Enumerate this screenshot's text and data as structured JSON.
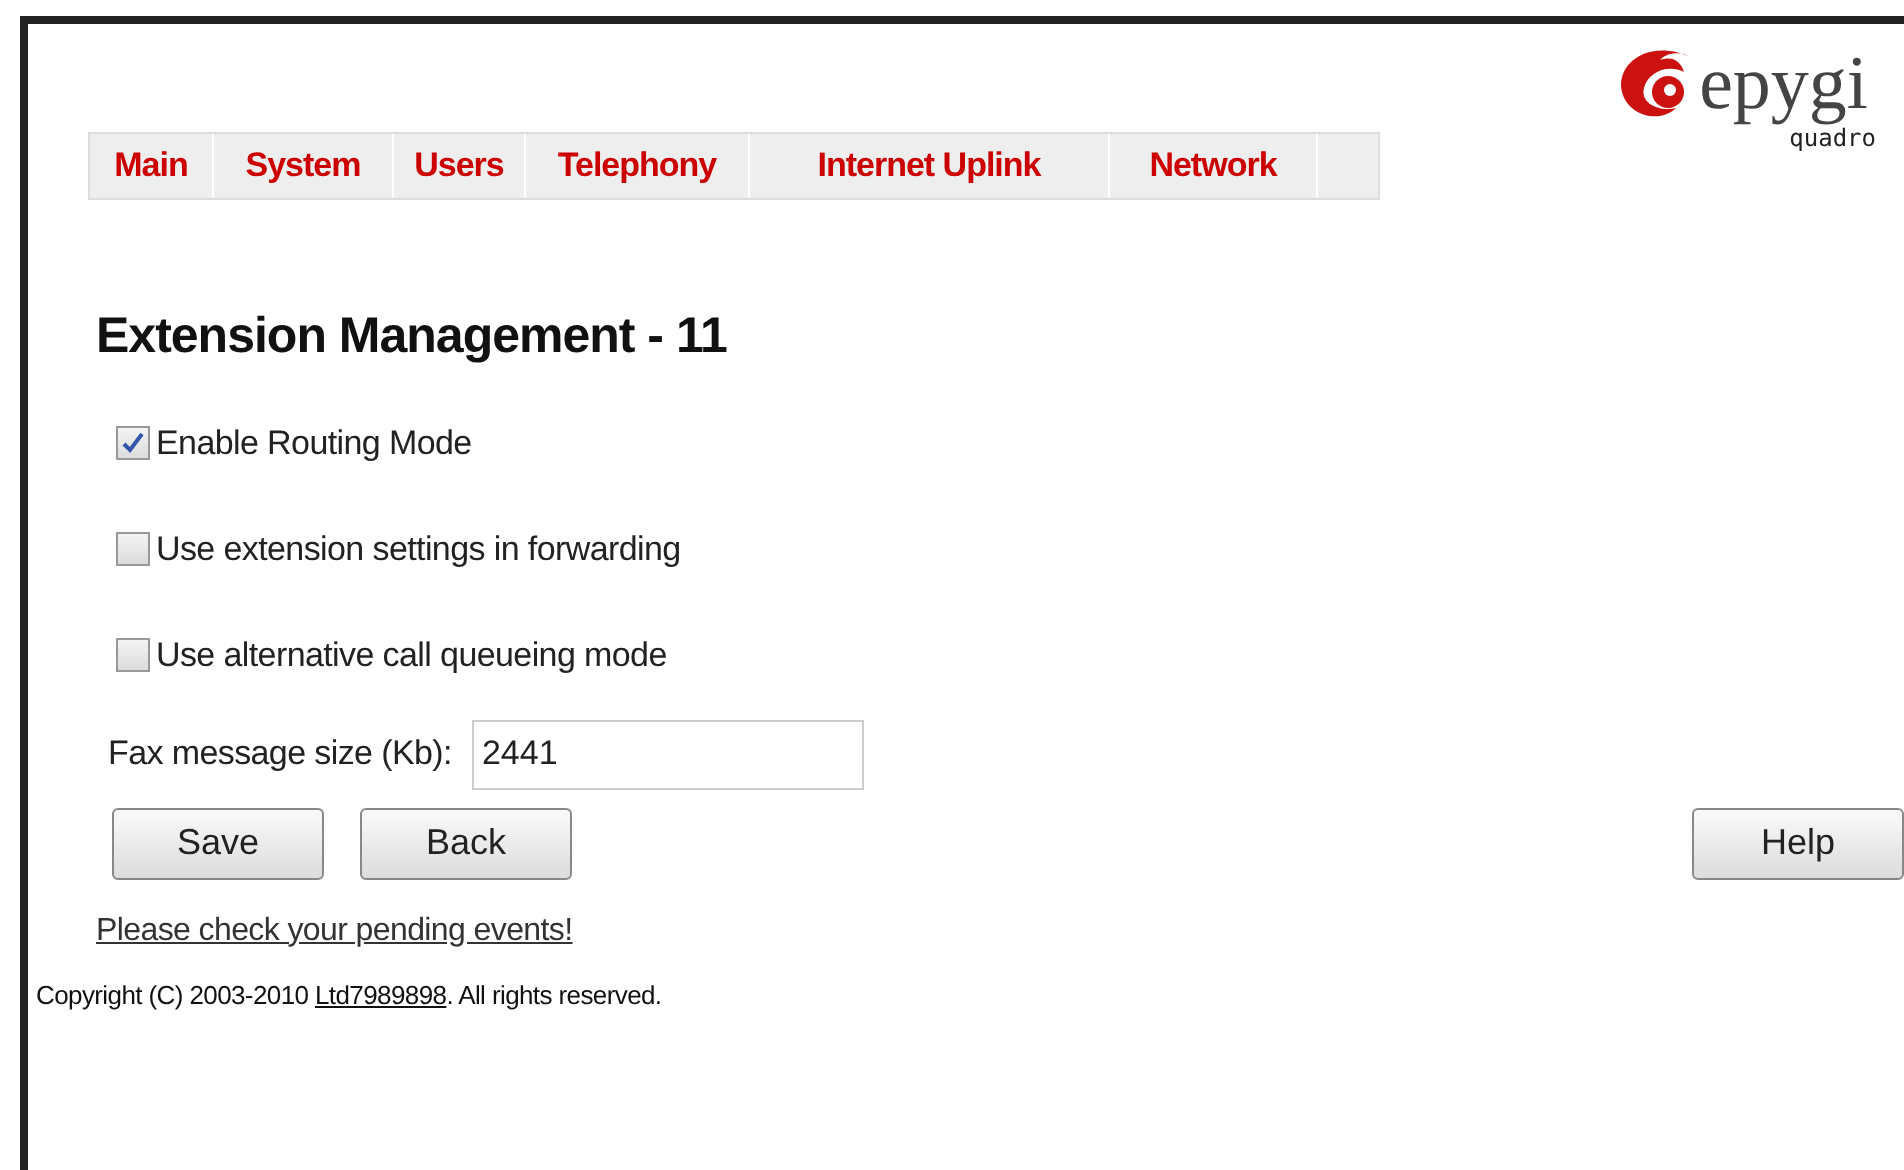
{
  "menu": [
    {
      "label": "Main"
    },
    {
      "label": "System"
    },
    {
      "label": "Users"
    },
    {
      "label": "Telephony"
    },
    {
      "label": "Internet Uplink"
    },
    {
      "label": "Network"
    }
  ],
  "logo": {
    "name": "epygi",
    "subtitle": "quadro"
  },
  "title": "Extension Management - 11",
  "options": [
    {
      "label": "Enable Routing Mode",
      "checked": true
    },
    {
      "label": "Use extension settings in forwarding",
      "checked": false
    },
    {
      "label": "Use alternative call queueing mode",
      "checked": false
    }
  ],
  "fax": {
    "label": "Fax message size (Kb):",
    "value": "2441"
  },
  "buttons": [
    "Save",
    "Back"
  ],
  "help_button": "Help",
  "pending_link": "Please check your pending events!",
  "copyright": {
    "before": "Copyright (C) 2003-2010",
    "link": "Ltd7989898",
    "after": ". All rights reserved."
  }
}
